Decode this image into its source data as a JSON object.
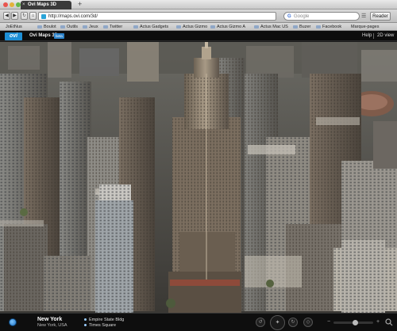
{
  "browser": {
    "tab_title": "Ovi Maps 3D",
    "tab_close": "×",
    "new_tab": "+",
    "url": "http://maps.ovi.com/3d/",
    "search_placeholder": "Google",
    "reader_label": "Reader",
    "page_menu": "☰",
    "back": "◀",
    "forward": "▶",
    "reload": "↻",
    "home": "⌂",
    "bookmarks": [
      {
        "label": "JoEtNus",
        "folder": false
      },
      {
        "label": "Boulot",
        "folder": true
      },
      {
        "label": "Outils",
        "folder": true
      },
      {
        "label": "Jeux",
        "folder": true
      },
      {
        "label": "Twitter",
        "folder": true
      },
      {
        "label": "Actus Gadgets",
        "folder": true
      },
      {
        "label": "Actus Gizmo",
        "folder": true
      },
      {
        "label": "Actus Gizmo A",
        "folder": true
      },
      {
        "label": "Actus Mac US",
        "folder": true
      },
      {
        "label": "Buzer",
        "folder": true
      },
      {
        "label": "Facebook",
        "folder": true
      },
      {
        "label": "Marque-pages",
        "folder": false
      }
    ]
  },
  "app": {
    "logo": "ovi",
    "title": "Ovi Maps 3D",
    "badge": "beta",
    "help": "Help",
    "view_toggle": "2D view"
  },
  "map": {
    "icon": "map-3d-view"
  },
  "info": {
    "city": "New York",
    "subtitle": "New York, USA",
    "pois": [
      "Empire State Bldg",
      "Times Square"
    ]
  },
  "controls": {
    "compass": "✦",
    "rotate_left": "↺",
    "rotate_right": "↻",
    "tilt": "◇",
    "zoom_level": 0.55,
    "zoom_minus": "−",
    "zoom_plus": "+"
  },
  "colors": {
    "accent": "#1d8fd6",
    "app_bar": "#0d0d0d"
  }
}
